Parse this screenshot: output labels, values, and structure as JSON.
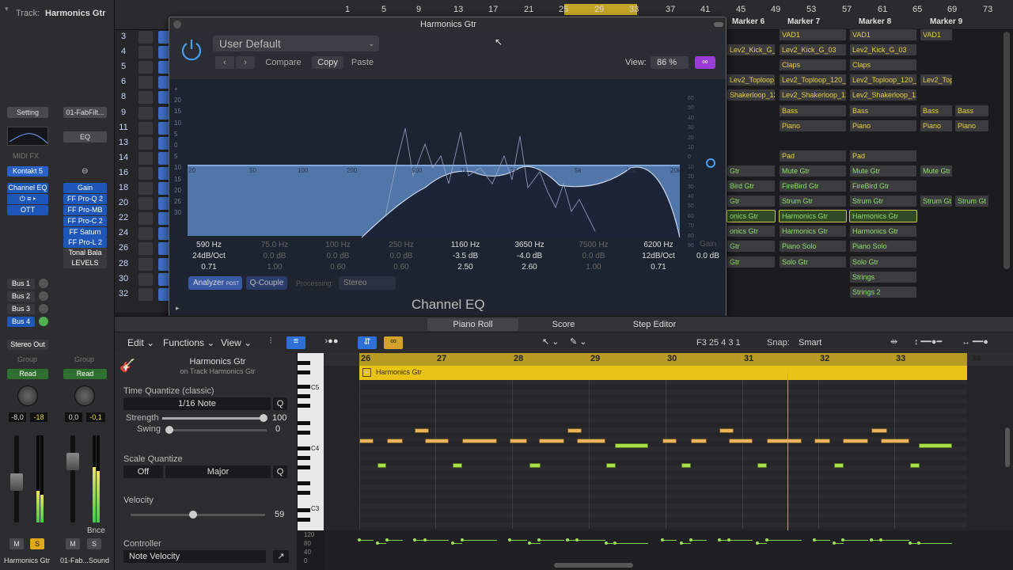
{
  "inspector": {
    "track_label": "Track:",
    "track_name": "Harmonics Gtr",
    "setting": "Setting",
    "preset": "01-FabFilt...",
    "eq": "EQ",
    "midi_fx": "MIDI FX",
    "instrument": "Kontakt 5",
    "chan_eq": "Channel EQ",
    "ott": "OTT",
    "plugins": [
      "Gain",
      "FF Pro-Q 2",
      "FF Pro-MB",
      "FF Pro-C 2",
      "FF Saturn",
      "FF Pro-L 2",
      "Tonal Bala",
      "LEVELS"
    ],
    "sends": [
      "Bus 1",
      "Bus 2",
      "Bus 3",
      "Bus 4"
    ],
    "output": "Stereo Out",
    "group": "Group",
    "read": "Read",
    "vol_left": "-8,0",
    "peak_left": "-18",
    "vol_right": "0,0",
    "peak_right": "-0,1",
    "bnce": "Bnce",
    "m": "M",
    "s": "S",
    "name_left": "Harmonics Gtr",
    "name_right": "01-Fab...Sound"
  },
  "ruler": {
    "bars": [
      "1",
      "5",
      "9",
      "13",
      "17",
      "21",
      "25",
      "29",
      "33",
      "37",
      "41",
      "45",
      "49",
      "53",
      "57",
      "61",
      "65",
      "69",
      "73"
    ],
    "markers": [
      "Marker 6",
      "Marker 7",
      "Marker 8",
      "Marker 9"
    ]
  },
  "tracks": {
    "numbers": [
      "3",
      "4",
      "5",
      "6",
      "8",
      "9",
      "11",
      "13",
      "14",
      "16",
      "18",
      "20",
      "22",
      "24",
      "26",
      "28",
      "30",
      "32"
    ]
  },
  "regions": [
    {
      "t": "VAD1",
      "c": "y"
    },
    {
      "t": "VAD1",
      "c": "y"
    },
    {
      "t": "VAD1",
      "c": "y"
    },
    {
      "t": "Lev2_Kick_G_03",
      "c": "y"
    },
    {
      "t": "Lev2_Kick_G_03",
      "c": "y"
    },
    {
      "t": "Lev2_Kick_G_03",
      "c": "y"
    },
    {
      "t": "Claps",
      "c": "y"
    },
    {
      "t": "Claps",
      "c": "y"
    },
    {
      "t": "Lev2_Toploop_120_",
      "c": "y"
    },
    {
      "t": "Lev2_Toploop_120_",
      "c": "y"
    },
    {
      "t": "Lev2_Toploop_120_0",
      "c": "y"
    },
    {
      "t": "Lev2_Top",
      "c": "y"
    },
    {
      "t": "Shakerloop_12",
      "c": "y"
    },
    {
      "t": "Lev2_Shakerloop_12",
      "c": "y"
    },
    {
      "t": "Lev2_Shakerloop_12",
      "c": "y"
    },
    {
      "t": "Bass",
      "c": "y"
    },
    {
      "t": "Bass",
      "c": "y"
    },
    {
      "t": "Bass",
      "c": "y"
    },
    {
      "t": "Bass",
      "c": "y"
    },
    {
      "t": "Piano",
      "c": "y"
    },
    {
      "t": "Piano",
      "c": "y"
    },
    {
      "t": "Piano",
      "c": "y"
    },
    {
      "t": "Piano",
      "c": "y"
    },
    {
      "t": "Pad",
      "c": "y"
    },
    {
      "t": "Pad",
      "c": "y"
    },
    {
      "t": "Gtr",
      "c": "g"
    },
    {
      "t": "Mute Gtr",
      "c": "g"
    },
    {
      "t": "Mute Gtr",
      "c": "g"
    },
    {
      "t": "Mute Gtr",
      "c": "g"
    },
    {
      "t": "Bird Gtr",
      "c": "g"
    },
    {
      "t": "FireBird Gtr",
      "c": "g"
    },
    {
      "t": "FireBird Gtr",
      "c": "g"
    },
    {
      "t": "Gtr",
      "c": "g"
    },
    {
      "t": "Strum Gtr",
      "c": "g"
    },
    {
      "t": "Strum Gtr",
      "c": "g"
    },
    {
      "t": "Strum Gt",
      "c": "g"
    },
    {
      "t": "Strum Gt",
      "c": "g"
    },
    {
      "t": "onics Gtr",
      "c": "g"
    },
    {
      "t": "Harmonics Gtr",
      "c": "g"
    },
    {
      "t": "Harmonics Gtr",
      "c": "g"
    },
    {
      "t": "onics Gtr",
      "c": "g"
    },
    {
      "t": "Harmonics Gtr",
      "c": "g"
    },
    {
      "t": "Harmonics Gtr",
      "c": "g"
    },
    {
      "t": "Gtr",
      "c": "g"
    },
    {
      "t": "Piano Solo",
      "c": "g"
    },
    {
      "t": "Piano Solo",
      "c": "g"
    },
    {
      "t": "Gtr",
      "c": "g"
    },
    {
      "t": "Solo Gtr",
      "c": "g"
    },
    {
      "t": "Solo Gtr",
      "c": "g"
    },
    {
      "t": "Strings",
      "c": "g"
    },
    {
      "t": "Strings 2",
      "c": "g"
    }
  ],
  "eq": {
    "title": "Harmonics Gtr",
    "preset": "User Default",
    "compare": "Compare",
    "copy": "Copy",
    "paste": "Paste",
    "view_label": "View:",
    "view_value": "86 %",
    "freq_labels": [
      "20",
      "50",
      "100",
      "200",
      "500",
      "1k",
      "2k",
      "5k",
      "10k",
      "20k"
    ],
    "db_left": [
      "+",
      "20",
      "15",
      "10",
      "5",
      "0",
      "5",
      "10",
      "15",
      "20",
      "25",
      "30"
    ],
    "db_right": [
      "60",
      "50",
      "40",
      "30",
      "20",
      "10",
      "0",
      "10",
      "20",
      "30",
      "40",
      "50",
      "60",
      "70",
      "80",
      "90"
    ],
    "bands": [
      {
        "f": "590 Hz",
        "g": "24dB/Oct",
        "q": "0.71",
        "active": true
      },
      {
        "f": "75.0 Hz",
        "g": "0.0 dB",
        "q": "1.00",
        "active": false
      },
      {
        "f": "100 Hz",
        "g": "0.0 dB",
        "q": "0.60",
        "active": false
      },
      {
        "f": "250 Hz",
        "g": "0.0 dB",
        "q": "0.60",
        "active": false
      },
      {
        "f": "1160 Hz",
        "g": "-3.5 dB",
        "q": "2.50",
        "active": true
      },
      {
        "f": "3650 Hz",
        "g": "-4.0 dB",
        "q": "2.60",
        "active": true
      },
      {
        "f": "7500 Hz",
        "g": "0.0 dB",
        "q": "1.00",
        "active": false
      },
      {
        "f": "6200 Hz",
        "g": "12dB/Oct",
        "q": "0.71",
        "active": true
      }
    ],
    "gain_label": "Gain",
    "gain_value": "0.0 dB",
    "analyzer": "Analyzer",
    "post": "POST",
    "q_couple": "Q-Couple",
    "processing": "Processing:",
    "stereo": "Stereo",
    "name": "Channel EQ"
  },
  "editor": {
    "tabs": [
      "Piano Roll",
      "Score",
      "Step Editor"
    ],
    "menus": [
      "Edit",
      "Functions",
      "View"
    ],
    "position": "F3   25 4 3 1",
    "snap_label": "Snap:",
    "snap_value": "Smart"
  },
  "pr": {
    "region_name": "Harmonics Gtr",
    "on_track": "on Track Harmonics Gtr",
    "tq_label": "Time Quantize (classic)",
    "tq_value": "1/16 Note",
    "q": "Q",
    "strength_label": "Strength",
    "strength_value": "100",
    "swing_label": "Swing",
    "swing_value": "0",
    "sq_label": "Scale Quantize",
    "sq_off": "Off",
    "sq_scale": "Major",
    "velocity_label": "Velocity",
    "velocity_value": "59",
    "controller_label": "Controller",
    "controller_value": "Note Velocity",
    "bars": [
      "26",
      "27",
      "28",
      "29",
      "30",
      "31",
      "32",
      "33",
      "34"
    ],
    "region_label": "Harmonics Gtr",
    "keys": [
      "C5",
      "C4",
      "C3"
    ],
    "vel_scale": [
      "120",
      "80",
      "40",
      "0"
    ]
  }
}
